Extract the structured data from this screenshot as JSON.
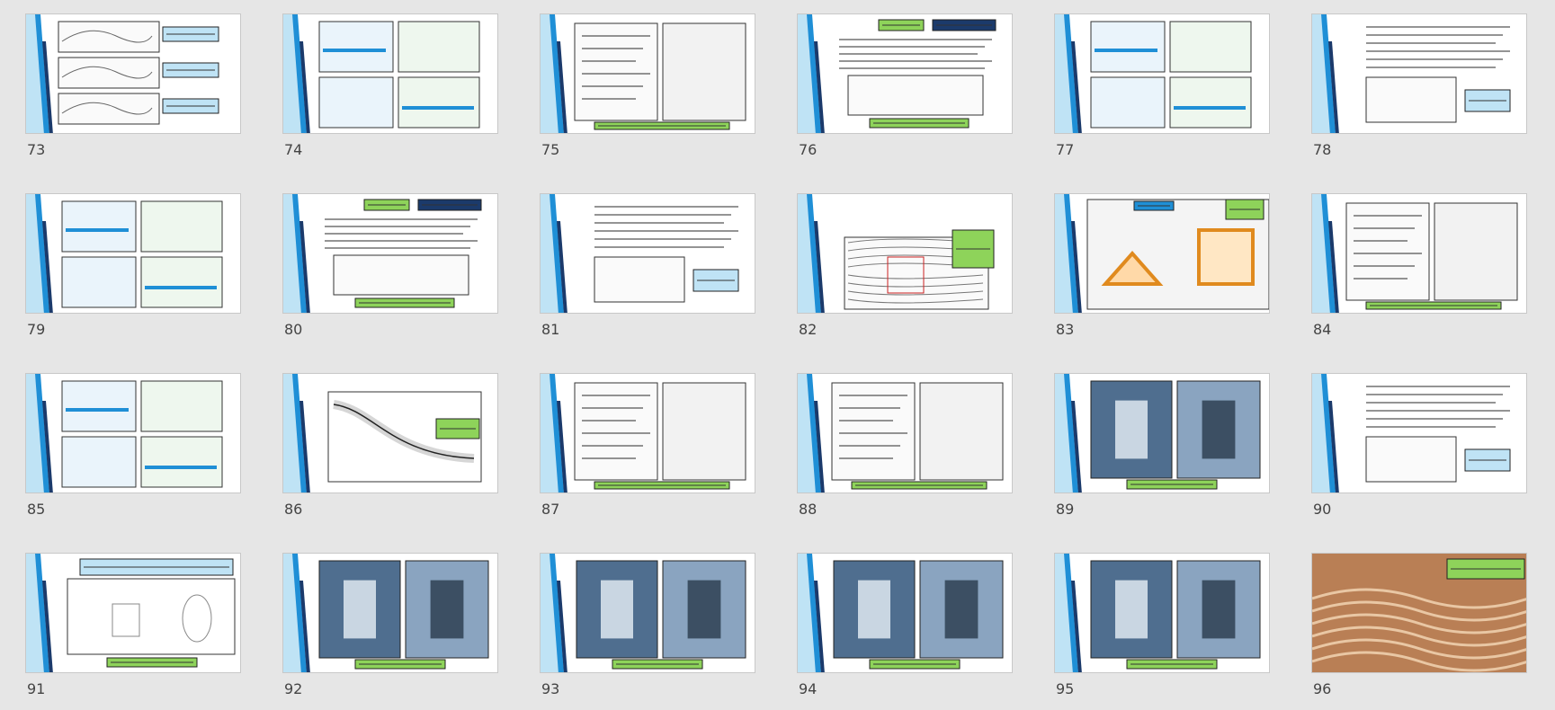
{
  "colors": {
    "background": "#e6e6e6",
    "accent_blue": "#1f8fd6",
    "accent_light": "#bfe3f5",
    "accent_dark": "#1b3a6b",
    "green_label": "#8ed35a",
    "yellow_label": "#ffe066",
    "red_mark": "#cc2222"
  },
  "slides": [
    {
      "number": "73",
      "layout": "stack3"
    },
    {
      "number": "74",
      "layout": "quad"
    },
    {
      "number": "75",
      "layout": "two"
    },
    {
      "number": "76",
      "layout": "heading"
    },
    {
      "number": "77",
      "layout": "quad"
    },
    {
      "number": "78",
      "layout": "text"
    },
    {
      "number": "79",
      "layout": "quad"
    },
    {
      "number": "80",
      "layout": "heading"
    },
    {
      "number": "81",
      "layout": "text"
    },
    {
      "number": "82",
      "layout": "flow"
    },
    {
      "number": "83",
      "layout": "house"
    },
    {
      "number": "84",
      "layout": "two"
    },
    {
      "number": "85",
      "layout": "quad"
    },
    {
      "number": "86",
      "layout": "graph"
    },
    {
      "number": "87",
      "layout": "two"
    },
    {
      "number": "88",
      "layout": "two"
    },
    {
      "number": "89",
      "layout": "photos"
    },
    {
      "number": "90",
      "layout": "text"
    },
    {
      "number": "91",
      "layout": "sketch"
    },
    {
      "number": "92",
      "layout": "photos"
    },
    {
      "number": "93",
      "layout": "photos"
    },
    {
      "number": "94",
      "layout": "photos"
    },
    {
      "number": "95",
      "layout": "photos"
    },
    {
      "number": "96",
      "layout": "fullphoto"
    }
  ]
}
